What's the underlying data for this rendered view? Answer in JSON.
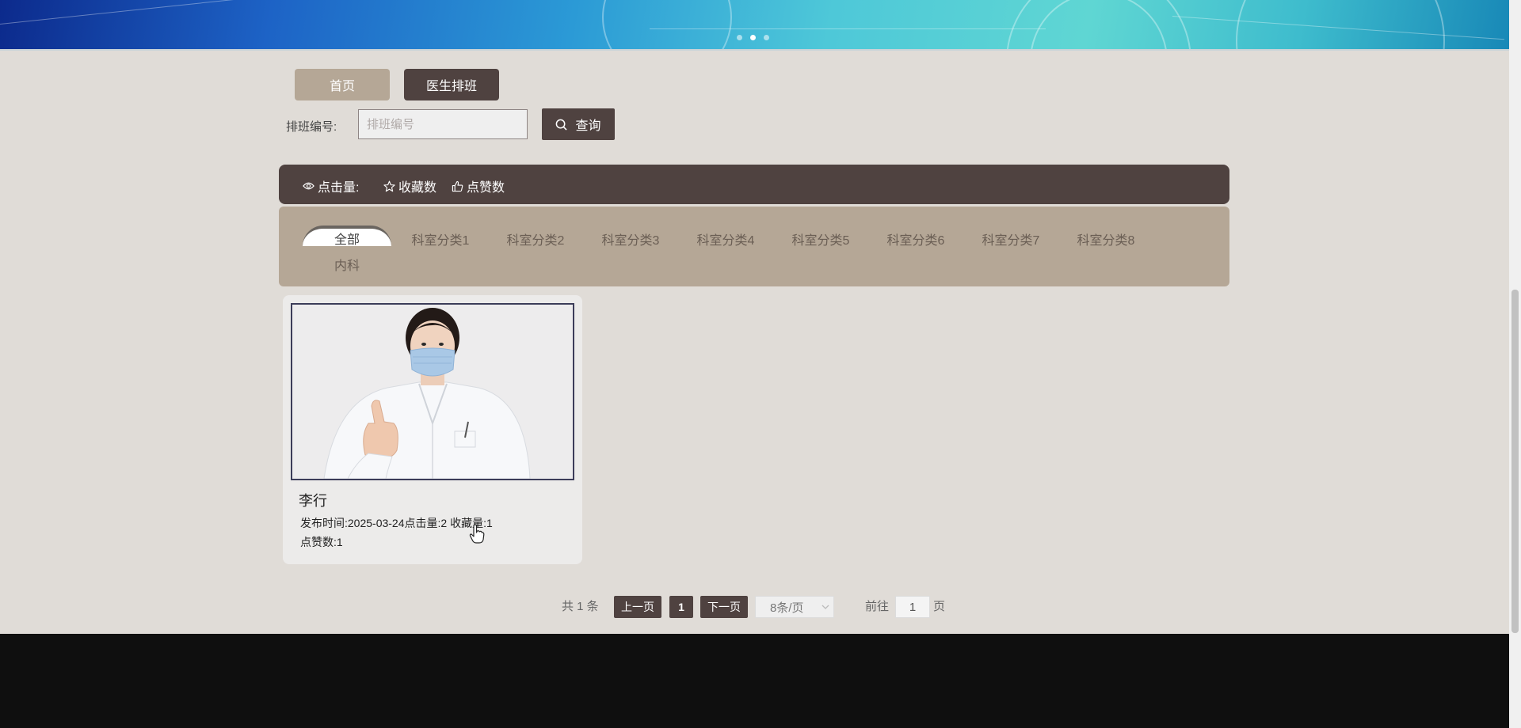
{
  "nav": {
    "home_label": "首页",
    "schedule_label": "医生排班"
  },
  "search": {
    "label": "排班编号:",
    "placeholder": "排班编号",
    "button_label": "查询"
  },
  "sort": {
    "clicks_label": "点击量:",
    "favorites_label": "收藏数",
    "likes_label": "点赞数"
  },
  "categories": {
    "items": [
      "全部",
      "科室分类1",
      "科室分类2",
      "科室分类3",
      "科室分类4",
      "科室分类5",
      "科室分类6",
      "科室分类7",
      "科室分类8",
      "内科"
    ],
    "active": "全部"
  },
  "cards": [
    {
      "name": "李行",
      "publish_label": "发布时间:",
      "publish_date": "2025-03-24",
      "clicks_label": "点击量:",
      "clicks": "2",
      "favorites_label": "收藏量:",
      "favorites": "1",
      "likes_label": "点赞数:",
      "likes": "1"
    }
  ],
  "pagination": {
    "total_text": "共 1 条",
    "prev_label": "上一页",
    "current_page": "1",
    "next_label": "下一页",
    "page_size": "8条/页",
    "goto_label": "前往",
    "goto_value": "1",
    "page_suffix": "页"
  },
  "colors": {
    "primary": "#4f4240",
    "accent": "#b5a796",
    "background": "#e0dcd7",
    "footer": "#0f0f0f"
  }
}
